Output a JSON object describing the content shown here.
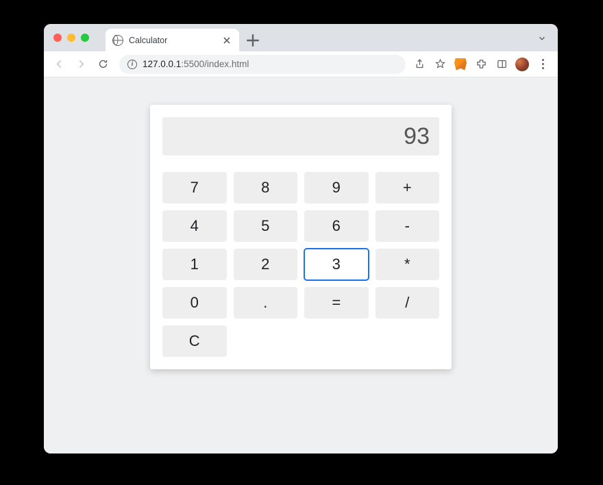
{
  "browser": {
    "tab_title": "Calculator",
    "address_host": "127.0.0.1",
    "address_port_path": ":5500/index.html"
  },
  "calculator": {
    "display": "93",
    "keys": {
      "k7": "7",
      "k8": "8",
      "k9": "9",
      "plus": "+",
      "k4": "4",
      "k5": "5",
      "k6": "6",
      "minus": "-",
      "k1": "1",
      "k2": "2",
      "k3": "3",
      "multiply": "*",
      "k0": "0",
      "dot": ".",
      "equals": "=",
      "divide": "/",
      "clear": "C"
    },
    "focused_key": "k3"
  }
}
